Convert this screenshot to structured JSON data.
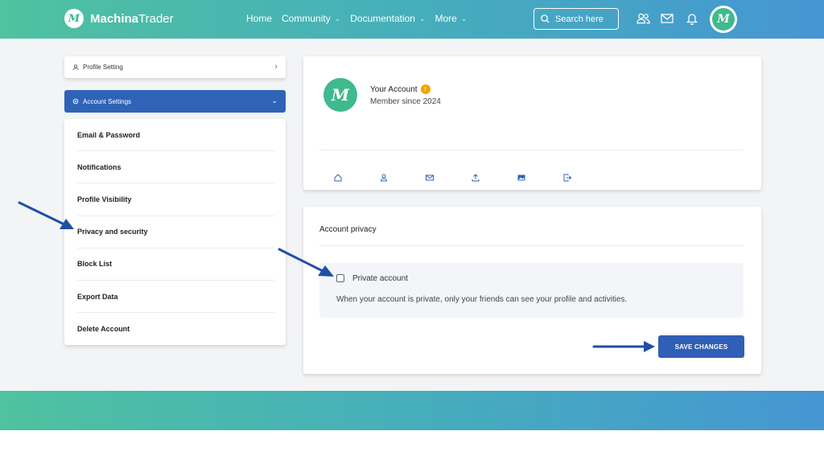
{
  "header": {
    "logo_letter": "M",
    "logo_brand_bold": "Machina",
    "logo_brand_rest": "Trader",
    "nav": [
      {
        "label": "Home",
        "has_dropdown": false
      },
      {
        "label": "Community",
        "has_dropdown": true
      },
      {
        "label": "Documentation",
        "has_dropdown": true
      },
      {
        "label": "More",
        "has_dropdown": true
      }
    ],
    "search_placeholder": "Search here",
    "icons": [
      "users-icon",
      "mail-icon",
      "bell-icon"
    ],
    "avatar_letter": "M"
  },
  "sidebar": {
    "profile_setting": "Profile Setting",
    "account_settings": "Account Settings",
    "items": [
      "Email & Password",
      "Notifications",
      "Profile Visibility",
      "Privacy and security",
      "Block List",
      "Export Data",
      "Delete Account"
    ]
  },
  "account_card": {
    "logo_letter": "M",
    "name": "Your Account",
    "badge": "!",
    "member_since": "Member since 2024",
    "tab_icons": [
      "home-icon",
      "user-icon",
      "mail-icon",
      "upload-icon",
      "image-icon",
      "logout-icon"
    ]
  },
  "privacy": {
    "title": "Account privacy",
    "checkbox_label": "Private account",
    "checked": false,
    "description": "When your account is private, only your friends can see your profile and activities.",
    "save_label": "SAVE CHANGES"
  },
  "colors": {
    "accent_blue": "#2f63b8",
    "brand_green": "#3fb98e",
    "gradient_start": "#4fc2a0",
    "gradient_end": "#4596d2",
    "annotation_arrow": "#1f4fa6"
  }
}
